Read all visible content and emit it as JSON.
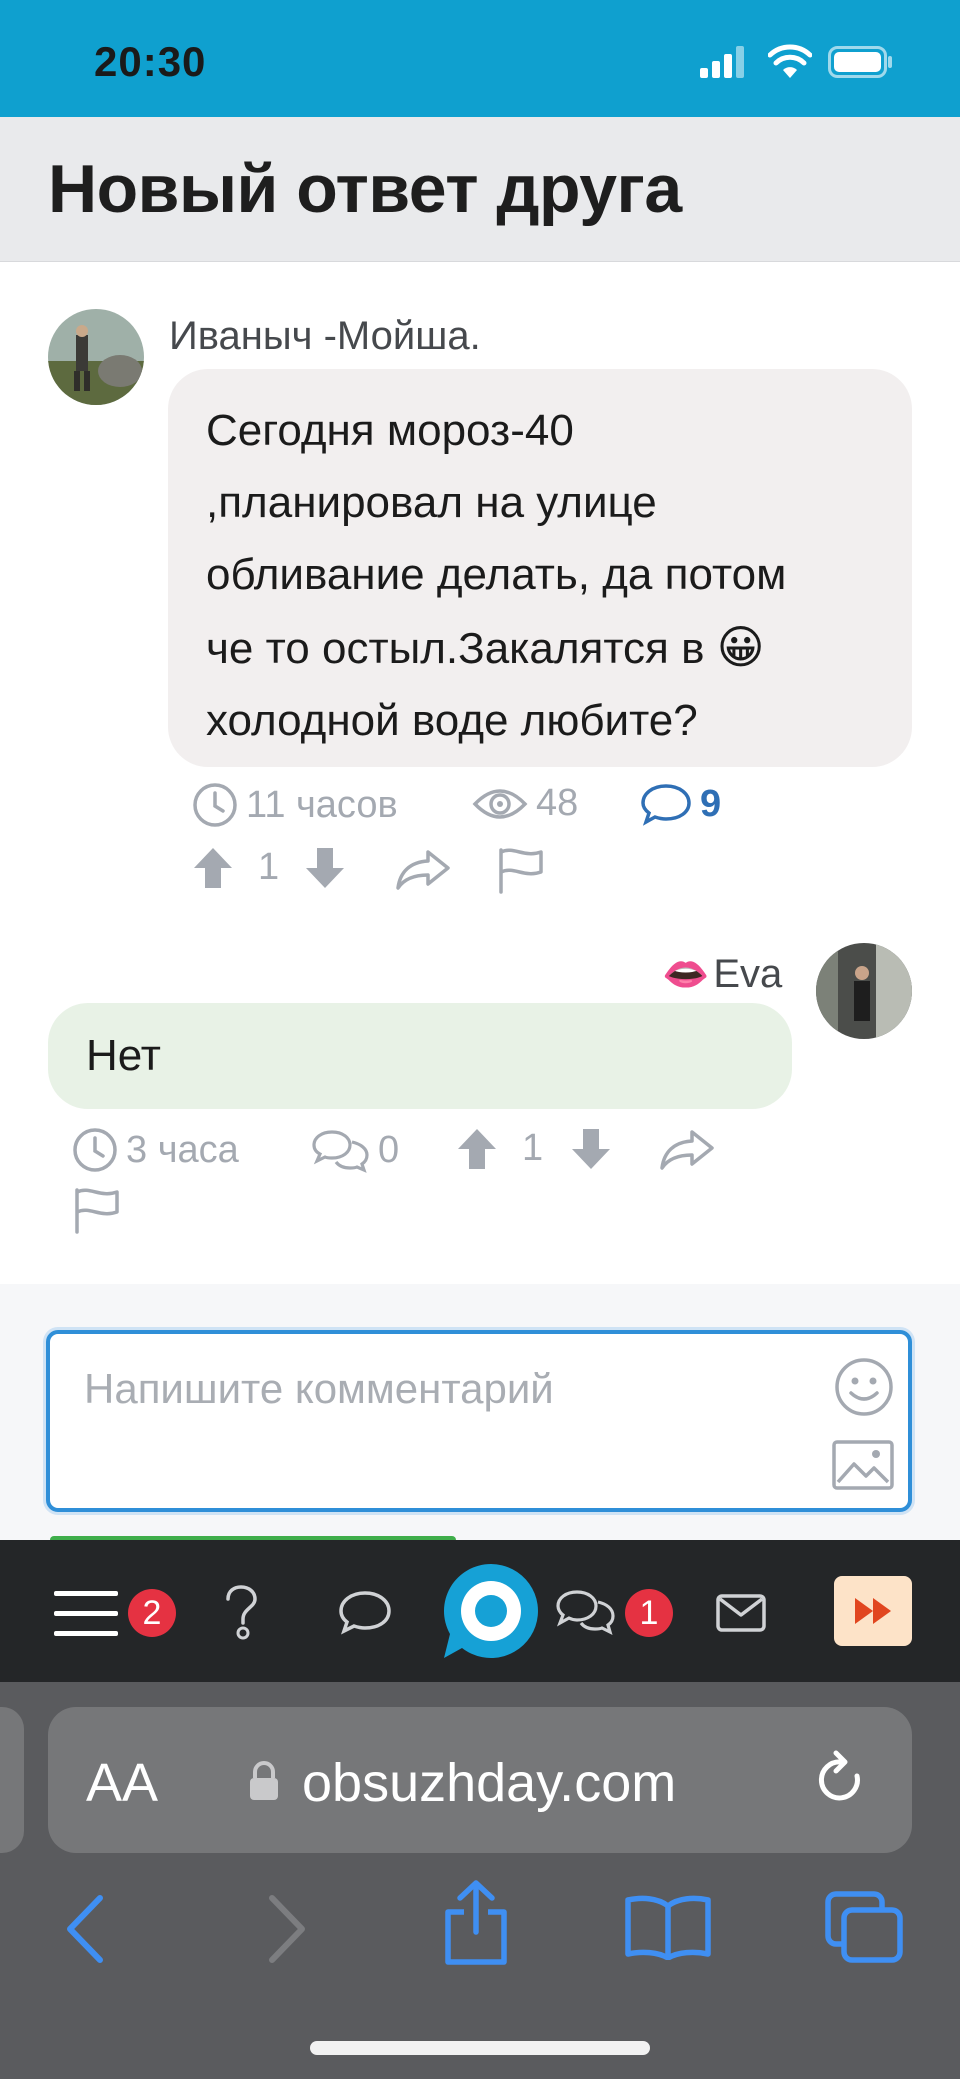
{
  "status_bar": {
    "time": "20:30"
  },
  "header": {
    "title": "Новый ответ друга"
  },
  "post": {
    "author": "Иваныч -Мойша.",
    "lines": [
      "Сегодня мороз-40",
      ",планировал на улице",
      "обливание делать, да потом",
      "че то остыл.Закалятся в",
      "холодной воде любите?"
    ],
    "emoji": "😀",
    "time": "11 часов",
    "views": "48",
    "comments": "9",
    "rating": "1"
  },
  "reply": {
    "author": "Eva",
    "author_emoji": "👄",
    "text": "Нет",
    "time": "3 часа",
    "comments": "0",
    "rating": "1"
  },
  "comment_input": {
    "placeholder": "Напишите комментарий"
  },
  "site_nav": {
    "menu_badge": "2",
    "chat_badge": "1"
  },
  "browser": {
    "aa": "AA",
    "domain": "obsuzhday.com"
  },
  "colors": {
    "status_bar": "#0fa0cf",
    "accent_blue": "#2f6fb5",
    "bubble_incoming": "#f2efef",
    "bubble_reply": "#e8f2e6",
    "badge_red": "#e53242"
  }
}
